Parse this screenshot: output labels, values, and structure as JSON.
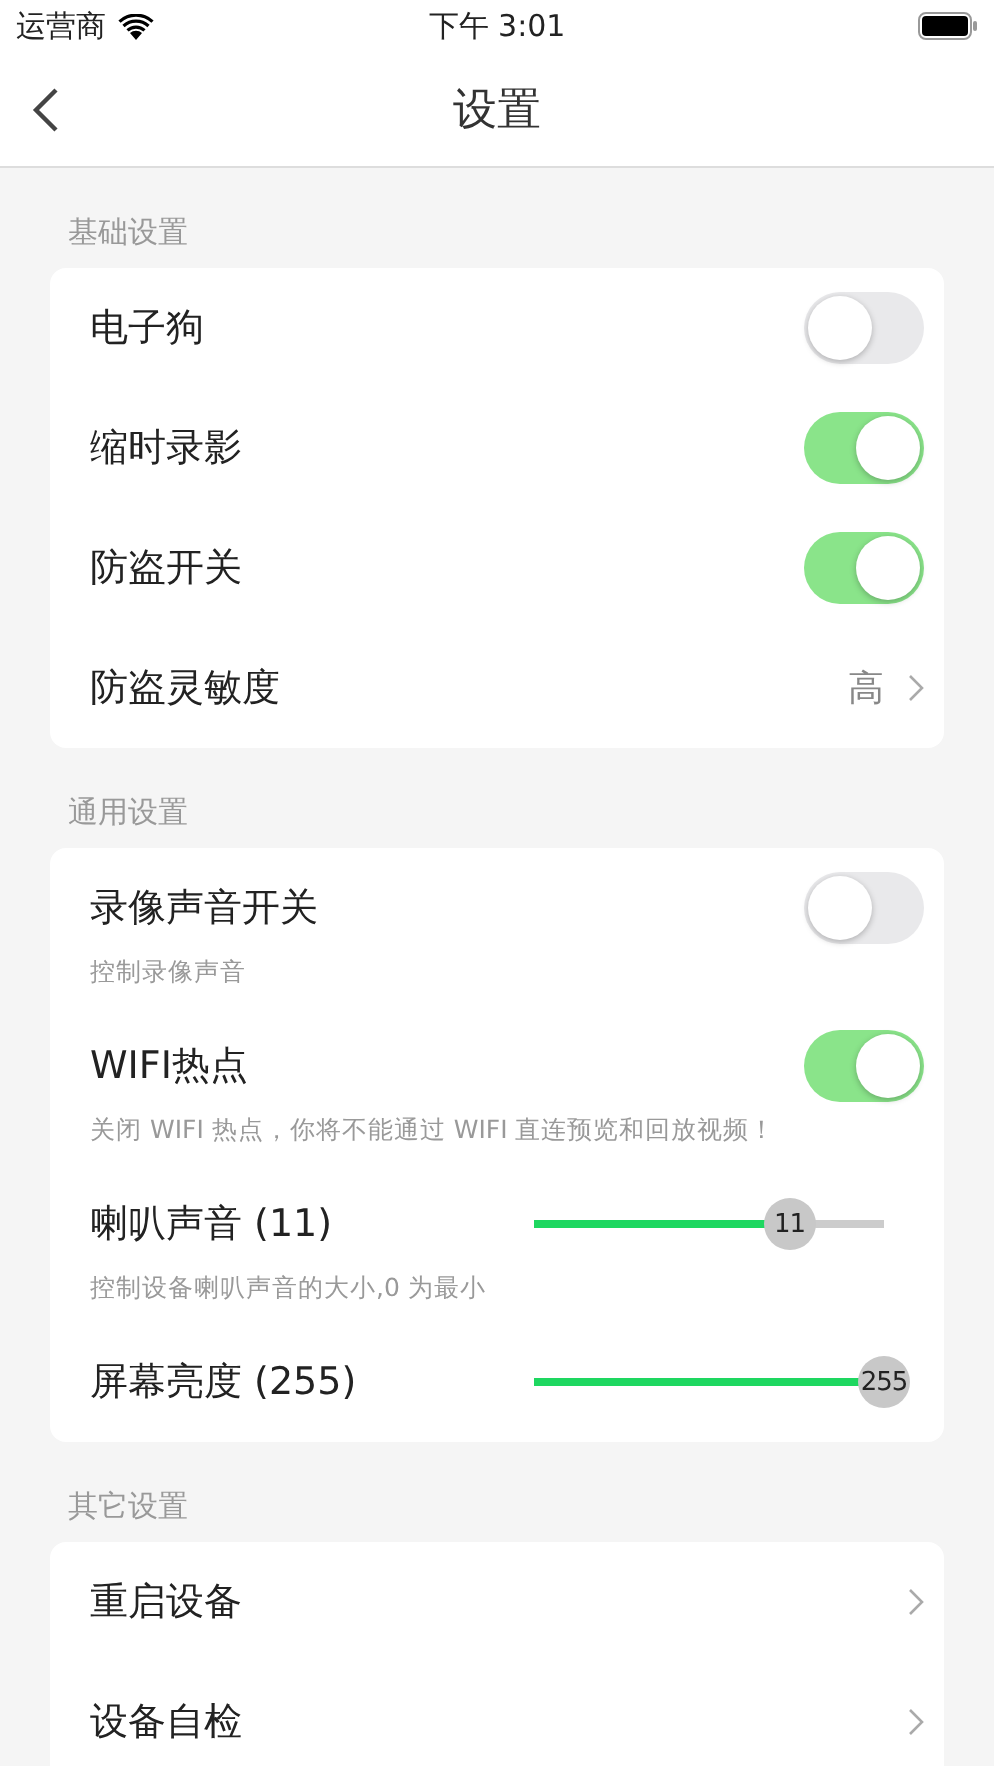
{
  "status_bar": {
    "carrier": "运营商",
    "time": "下午 3:01"
  },
  "nav": {
    "title": "设置"
  },
  "sections": [
    {
      "title": "基础设置",
      "items": [
        {
          "kind": "toggle",
          "label": "电子狗",
          "on": false
        },
        {
          "kind": "toggle",
          "label": "缩时录影",
          "on": true
        },
        {
          "kind": "toggle",
          "label": "防盗开关",
          "on": true
        },
        {
          "kind": "value",
          "label": "防盗灵敏度",
          "value": "高"
        }
      ]
    },
    {
      "title": "通用设置",
      "items": [
        {
          "kind": "toggle",
          "label": "录像声音开关",
          "on": false,
          "hint": "控制录像声音"
        },
        {
          "kind": "toggle",
          "label": "WIFI热点",
          "on": true,
          "hint": "关闭 WIFI 热点，你将不能通过 WIFI 直连预览和回放视频！"
        },
        {
          "kind": "slider",
          "label": "喇叭声音 (11)",
          "level": 0.73,
          "reading": "11",
          "hint": "控制设备喇叭声音的大小,0 为最小"
        },
        {
          "kind": "slider",
          "label": "屏幕亮度 (255)",
          "level": 1,
          "reading": "255"
        }
      ]
    },
    {
      "title": "其它设置",
      "items": [
        {
          "kind": "link",
          "label": "重启设备"
        },
        {
          "kind": "link",
          "label": "设备自检"
        }
      ]
    }
  ]
}
